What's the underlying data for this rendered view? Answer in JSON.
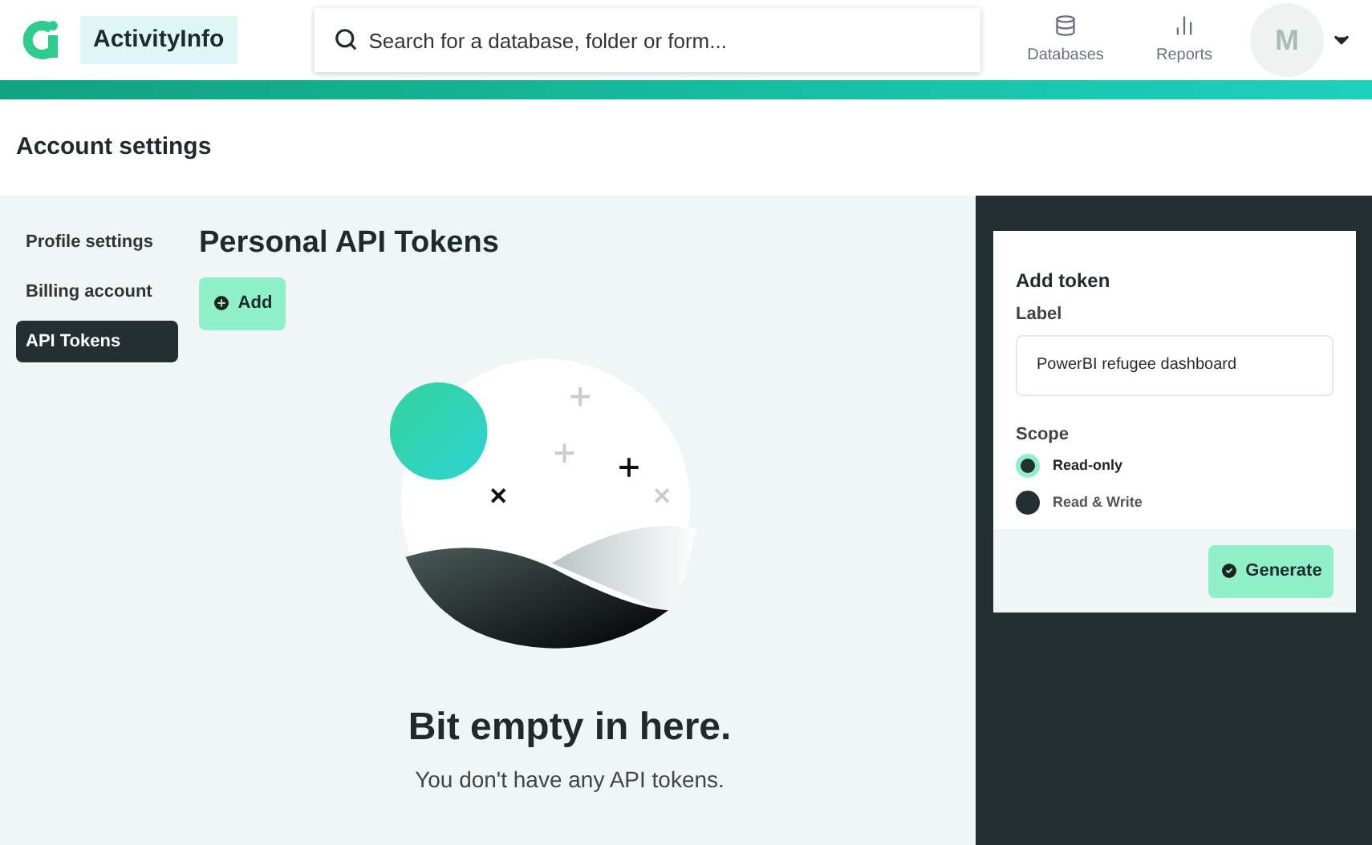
{
  "header": {
    "brand": "ActivityInfo",
    "search": {
      "placeholder": "Search for a database, folder or form..."
    },
    "nav": [
      {
        "label": "Databases",
        "kind": "database"
      },
      {
        "label": "Reports",
        "kind": "chart"
      }
    ],
    "avatar": "M"
  },
  "page_title": "Account settings",
  "sidebar": {
    "items": [
      {
        "label": "Profile settings",
        "selected": false
      },
      {
        "label": "Billing account",
        "selected": false
      },
      {
        "label": "API Tokens",
        "selected": true
      }
    ]
  },
  "main": {
    "title": "Personal API Tokens",
    "add_button": "Add",
    "empty_title": "Bit empty in here.",
    "empty_text": "You don't have any API tokens."
  },
  "panel": {
    "title": "Add token",
    "label_caption": "Label",
    "label_value": "PowerBI refugee dashboard",
    "scope_caption": "Scope",
    "scopes": [
      {
        "label": "Read-only",
        "selected": true
      },
      {
        "label": "Read & Write",
        "selected": false
      }
    ],
    "generate_button": "Generate"
  }
}
